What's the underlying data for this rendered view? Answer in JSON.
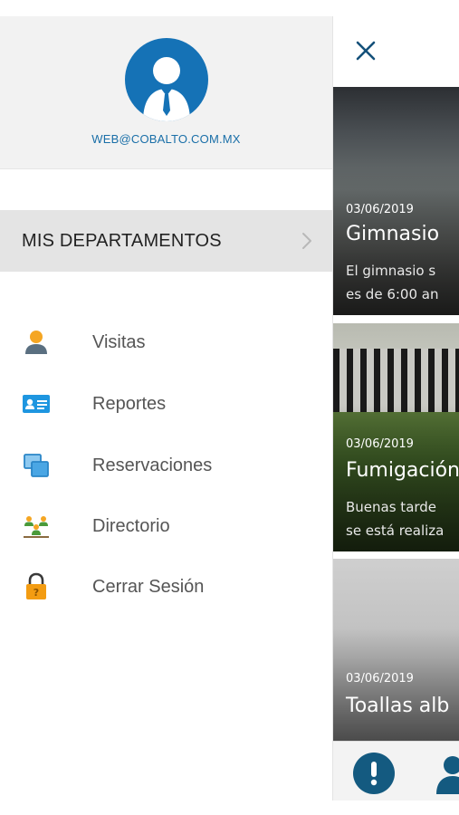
{
  "drawer": {
    "email": "WEB@COBALTO.COM.MX",
    "section_label": "MIS DEPARTAMENTOS",
    "menu": [
      {
        "label": "Visitas",
        "icon": "person-icon"
      },
      {
        "label": "Reportes",
        "icon": "id-card-icon"
      },
      {
        "label": "Reservaciones",
        "icon": "windows-icon"
      },
      {
        "label": "Directorio",
        "icon": "people-group-icon"
      },
      {
        "label": "Cerrar Sesión",
        "icon": "lock-icon"
      }
    ]
  },
  "news": [
    {
      "date": "03/06/2019",
      "title": "Gimnasio",
      "excerpt_line1": "El gimnasio s",
      "excerpt_line2": "es de 6:00 an"
    },
    {
      "date": "03/06/2019",
      "title": "Fumigación",
      "excerpt_line1": "Buenas tarde",
      "excerpt_line2": "se está realiza"
    },
    {
      "date": "03/06/2019",
      "title": "Toallas alb",
      "excerpt_line1": "",
      "excerpt_line2": ""
    }
  ],
  "colors": {
    "brand_blue": "#1572b6",
    "dark_blue": "#145a80",
    "section_bg": "#e4e4e4",
    "menu_text": "#555555"
  }
}
